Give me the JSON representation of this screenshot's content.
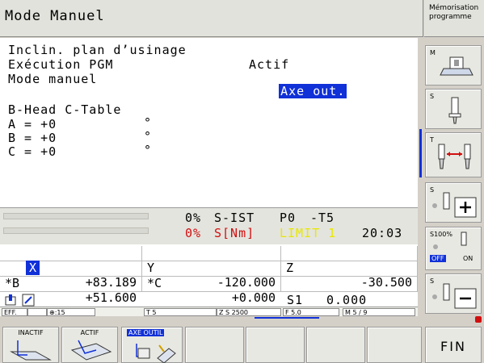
{
  "header": {
    "title": "Mode Manuel",
    "memo_line1": "Mémorisation",
    "memo_line2": "programme"
  },
  "main": {
    "line1": "Inclin. plan d’usinage",
    "line2_label": "Exécution PGM",
    "line2_value": "Actif",
    "line3_label": "Mode manuel",
    "line3_value": "Axe out.",
    "kinematics": "B-Head C-Table",
    "axes": [
      {
        "label": "A = +0",
        "unit": "°"
      },
      {
        "label": "B = +0",
        "unit": "°"
      },
      {
        "label": "C = +0",
        "unit": "°"
      }
    ]
  },
  "status": {
    "pct1": "0%",
    "sist": "S-IST",
    "p0": "P0",
    "t5": "-T5",
    "pct2": "0%",
    "snm": "S[Nm]",
    "limit": "LIMIT 1",
    "time": "20:03"
  },
  "positions": [
    {
      "label": "X",
      "value": "+83.189"
    },
    {
      "label": "Y",
      "value": "-120.000"
    },
    {
      "label": "Z",
      "value": "-30.500"
    },
    {
      "label": "*B",
      "value": "+51.600"
    },
    {
      "label": "*C",
      "value": "+0.000"
    }
  ],
  "spindle": {
    "label": "S1",
    "value": "0.000"
  },
  "info": {
    "eff": "EFF.",
    "f15": ":15",
    "t": "T 5",
    "zs": "Z S 2500",
    "f": "F 5.0",
    "m": "M 5 / 9"
  },
  "right_softkeys": [
    {
      "tag": "M"
    },
    {
      "tag": "S"
    },
    {
      "tag": "T"
    },
    {
      "tag": "S"
    },
    {
      "tag": "S100%",
      "off": "OFF",
      "on": "ON"
    },
    {
      "tag": "S"
    }
  ],
  "bottom_softkeys": {
    "inactif": "INACTIF",
    "actif": "ACTIF",
    "axe_outil": "AXE OUTIL",
    "fin": "FIN"
  },
  "colors": {
    "highlight": "#1030d8",
    "limit": "#e8e800",
    "red": "#d01010"
  }
}
